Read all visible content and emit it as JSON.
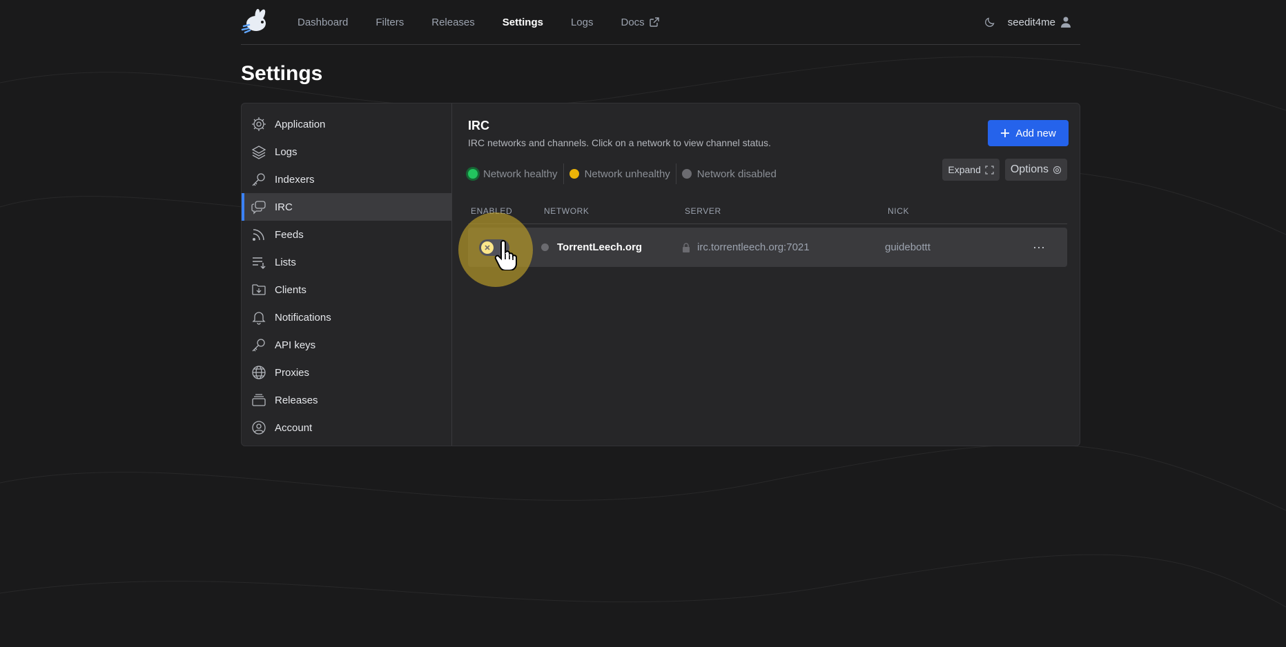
{
  "nav": {
    "links": [
      {
        "label": "Dashboard",
        "active": false
      },
      {
        "label": "Filters",
        "active": false
      },
      {
        "label": "Releases",
        "active": false
      },
      {
        "label": "Settings",
        "active": true
      },
      {
        "label": "Logs",
        "active": false
      },
      {
        "label": "Docs",
        "active": false,
        "icon": "external-link-icon"
      }
    ],
    "username": "seedit4me",
    "theme_icon": "moon-icon",
    "user_icon": "user-icon"
  },
  "page_title": "Settings",
  "sidebar": {
    "items": [
      {
        "label": "Application",
        "icon": "gear-icon",
        "active": false
      },
      {
        "label": "Logs",
        "icon": "layers-icon",
        "active": false
      },
      {
        "label": "Indexers",
        "icon": "key-icon",
        "active": false
      },
      {
        "label": "IRC",
        "icon": "chat-icon",
        "active": true
      },
      {
        "label": "Feeds",
        "icon": "rss-icon",
        "active": false
      },
      {
        "label": "Lists",
        "icon": "list-icon",
        "active": false
      },
      {
        "label": "Clients",
        "icon": "folder-download-icon",
        "active": false
      },
      {
        "label": "Notifications",
        "icon": "bell-icon",
        "active": false
      },
      {
        "label": "API keys",
        "icon": "key-icon",
        "active": false
      },
      {
        "label": "Proxies",
        "icon": "globe-icon",
        "active": false
      },
      {
        "label": "Releases",
        "icon": "inbox-stack-icon",
        "active": false
      },
      {
        "label": "Account",
        "icon": "user-circle-icon",
        "active": false
      }
    ]
  },
  "irc": {
    "title": "IRC",
    "description": "IRC networks and channels. Click on a network to view channel status.",
    "add_button": "Add new",
    "legend": [
      {
        "label": "Network healthy",
        "color": "#22c55e"
      },
      {
        "label": "Network unhealthy",
        "color": "#eab308"
      },
      {
        "label": "Network disabled",
        "color": "#6b6b70"
      }
    ],
    "expand_button": "Expand",
    "options_button": "Options",
    "columns": [
      "Enabled",
      "Network",
      "Server",
      "Nick"
    ],
    "rows": [
      {
        "enabled": false,
        "network": "TorrentLeech.org",
        "server": "irc.torrentleech.org:7021",
        "nick": "guidebottt",
        "actions": "···"
      }
    ]
  },
  "colors": {
    "accent": "#2563eb",
    "active_bar": "#3b82f6",
    "background": "#1a1a1b",
    "panel": "#262628"
  }
}
